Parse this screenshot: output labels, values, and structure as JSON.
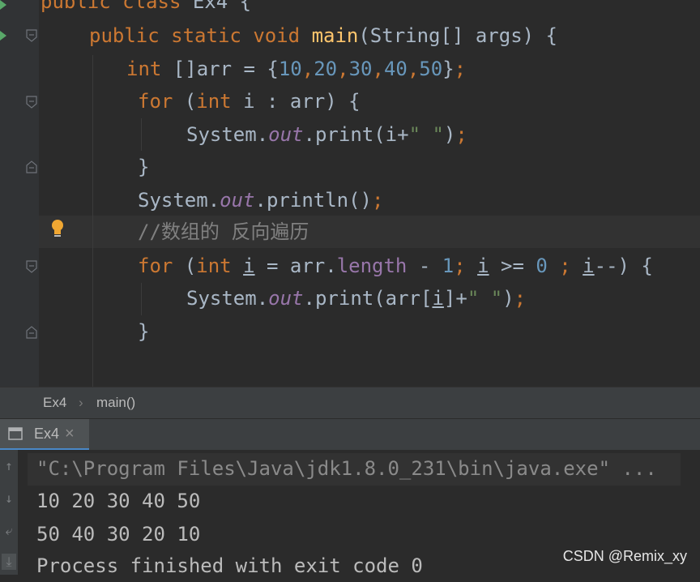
{
  "editor": {
    "line1": {
      "kw1": "public",
      "kw2": "class",
      "name": "Ex4",
      "brace": " {"
    },
    "line2": {
      "kw1": "public",
      "kw2": "static",
      "kw3": "void",
      "method": "main",
      "params": "(String[] args) {"
    },
    "line3": {
      "type": "int",
      "decl": " []arr = {",
      "n1": "10",
      "n2": "20",
      "n3": "30",
      "n4": "40",
      "n5": "50",
      "end": "}",
      "semi": ";"
    },
    "line4": {
      "kw": "for",
      "open": " (",
      "type": "int",
      "rest": " i : arr) {"
    },
    "line5": {
      "obj": "System.",
      "out": "out",
      "call": ".print(i+",
      "str": "\" \"",
      "close": ")",
      "semi": ";"
    },
    "line6": {
      "text": "}"
    },
    "line7": {
      "obj": "System.",
      "out": "out",
      "call": ".println()",
      "semi": ";"
    },
    "line8": {
      "comment": "//数组的 反向遍历"
    },
    "line9": {
      "kw": "for",
      "open": " (",
      "type": "int",
      "var": "i",
      "eq": " = arr.",
      "field": "length",
      "minus": " - ",
      "one": "1",
      "semi1": ";",
      "var2": "i",
      "cmp": " >= ",
      "zero": "0",
      "semi2": " ;",
      "var3": "i",
      "dec": "--) {"
    },
    "line10": {
      "obj": "System.",
      "out": "out",
      "call1": ".print(arr[",
      "var": "i",
      "call2": "]+",
      "str": "\" \"",
      "close": ")",
      "semi": ";"
    },
    "line11": {
      "text": "}"
    }
  },
  "breadcrumb": {
    "class": "Ex4",
    "sep": "›",
    "method": "main()"
  },
  "run_panel": {
    "tab_label": "Ex4",
    "close": "×"
  },
  "console": {
    "cmd": "\"C:\\Program Files\\Java\\jdk1.8.0_231\\bin\\java.exe\" ...",
    "out1": "10 20 30 40 50",
    "out2": "50 40 30 20 10",
    "exit": "Process finished with exit code 0"
  },
  "watermark": "CSDN @Remix_xy",
  "colors": {
    "keyword": "#cc7832",
    "number": "#6897bb",
    "string": "#6a8759",
    "field": "#9876aa",
    "method": "#ffc66d",
    "comment": "#808080",
    "text": "#a9b7c6"
  },
  "icons": [
    "run-gutter-icon",
    "fold-icon",
    "bulb-icon",
    "run-tab-icon",
    "close-icon",
    "scroll-up-icon",
    "scroll-down-icon",
    "soft-wrap-icon",
    "scroll-end-icon"
  ]
}
